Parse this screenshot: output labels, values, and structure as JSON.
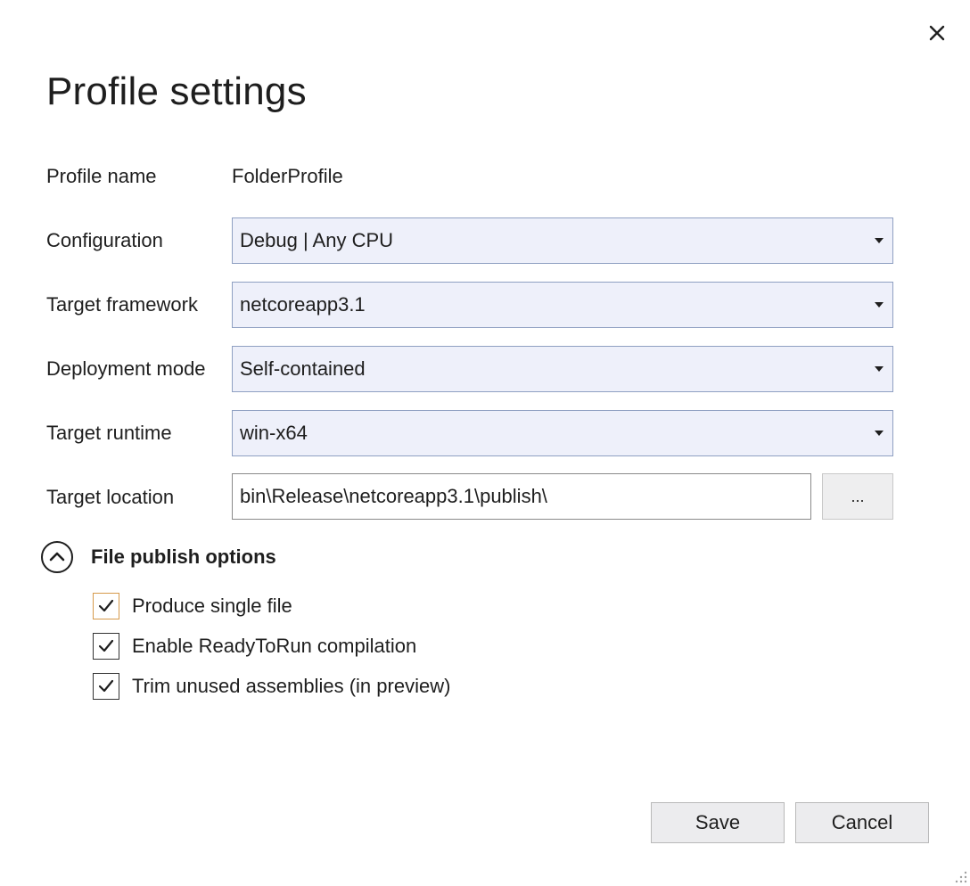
{
  "dialog": {
    "title": "Profile settings",
    "close_icon": "close-icon"
  },
  "fields": {
    "profile_name": {
      "label": "Profile name",
      "value": "FolderProfile"
    },
    "configuration": {
      "label": "Configuration",
      "value": "Debug | Any CPU"
    },
    "target_framework": {
      "label": "Target framework",
      "value": "netcoreapp3.1"
    },
    "deployment_mode": {
      "label": "Deployment mode",
      "value": "Self-contained"
    },
    "target_runtime": {
      "label": "Target runtime",
      "value": "win-x64"
    },
    "target_location": {
      "label": "Target location",
      "value": "bin\\Release\\netcoreapp3.1\\publish\\",
      "browse_label": "..."
    }
  },
  "file_publish_options": {
    "title": "File publish options",
    "expanded": true,
    "options": [
      {
        "label": "Produce single file",
        "checked": true
      },
      {
        "label": "Enable ReadyToRun compilation",
        "checked": true
      },
      {
        "label": "Trim unused assemblies (in preview)",
        "checked": true
      }
    ]
  },
  "buttons": {
    "save": "Save",
    "cancel": "Cancel"
  },
  "colors": {
    "combo_background": "#eef0fa",
    "combo_border": "#8fa0c2",
    "focus_border": "#d69a4b"
  }
}
